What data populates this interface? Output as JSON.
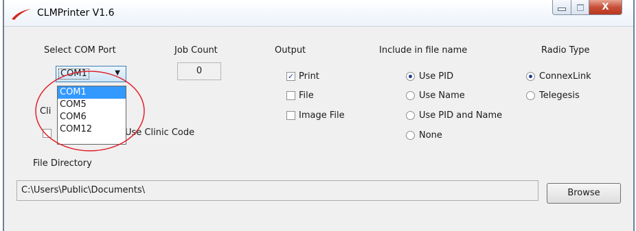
{
  "window": {
    "title": "CLMPrinter V1.6",
    "controls": {
      "close_glyph": "X"
    }
  },
  "com_port": {
    "label": "Select COM Port",
    "selected": "COM1",
    "options": [
      "COM1",
      "COM5",
      "COM6",
      "COM12"
    ]
  },
  "job_count": {
    "label": "Job Count",
    "value": "0"
  },
  "clinic": {
    "partial_label": "Cli",
    "use_clinic_code_label": "Use Clinic Code",
    "use_clinic_code_checked": false
  },
  "output": {
    "label": "Output",
    "options": [
      {
        "label": "Print",
        "checked": true
      },
      {
        "label": "File",
        "checked": false
      },
      {
        "label": "Image File",
        "checked": false
      }
    ]
  },
  "file_name": {
    "label": "Include in file name",
    "options": [
      {
        "label": "Use PID",
        "selected": true
      },
      {
        "label": "Use Name",
        "selected": false
      },
      {
        "label": "Use PID and Name",
        "selected": false
      },
      {
        "label": "None",
        "selected": false
      }
    ]
  },
  "radio_type": {
    "label": "Radio Type",
    "options": [
      {
        "label": "ConnexLink",
        "selected": true
      },
      {
        "label": "Telegesis",
        "selected": false
      }
    ]
  },
  "file_directory": {
    "label": "File Directory",
    "path": "C:\\Users\\Public\\Documents\\"
  },
  "browse": {
    "label": "Browse"
  },
  "colors": {
    "accent": "#3399ff",
    "annotation": "#e0202a",
    "close": "#c8503a"
  },
  "icons": [
    "app-swoosh-icon",
    "minimize-icon",
    "maximize-icon",
    "close-icon",
    "chevron-down-icon"
  ]
}
